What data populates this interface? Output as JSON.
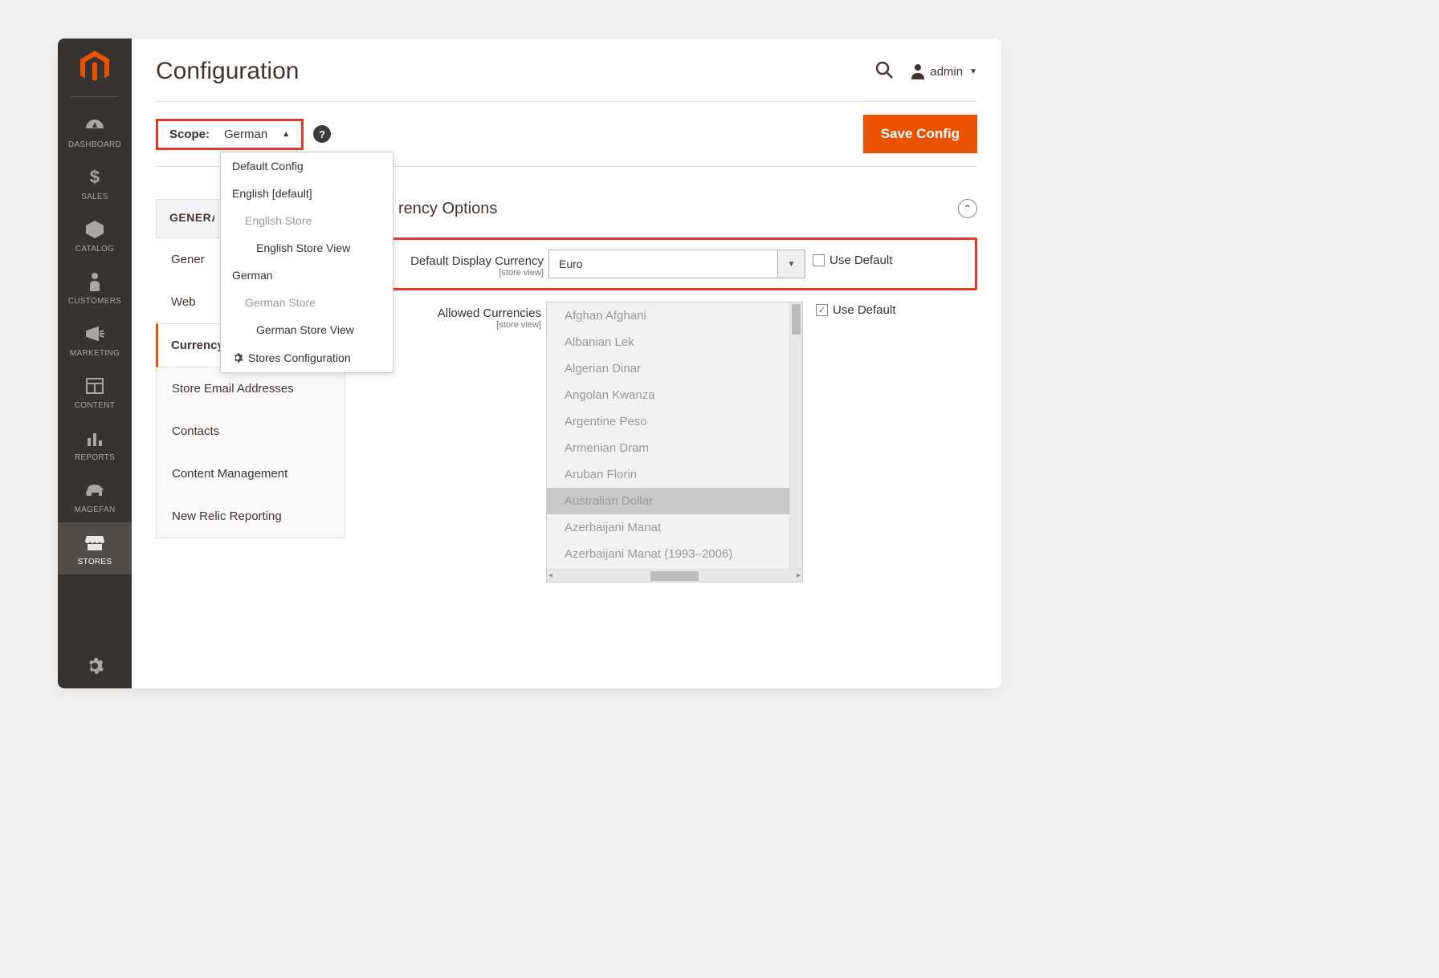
{
  "header": {
    "title": "Configuration",
    "user_label": "admin"
  },
  "scope": {
    "label": "Scope:",
    "value": "German",
    "options": [
      {
        "text": "Default Config",
        "indent": 0
      },
      {
        "text": "English [default]",
        "indent": 0
      },
      {
        "text": "English Store",
        "indent": 1
      },
      {
        "text": "English Store View",
        "indent": 2
      },
      {
        "text": "German",
        "indent": 0
      },
      {
        "text": "German Store",
        "indent": 1
      },
      {
        "text": "German Store View",
        "indent": 2
      }
    ],
    "stores_config": "Stores Configuration"
  },
  "actions": {
    "save": "Save Config"
  },
  "section_nav": {
    "group_label": "GENERAL",
    "items": [
      "General",
      "Web",
      "Currency Setup",
      "Store Email Addresses",
      "Contacts",
      "Content Management",
      "New Relic Reporting"
    ],
    "active_index": 2,
    "truncated": {
      "0": "Gener",
      "1": "Web"
    }
  },
  "panel": {
    "title_suffix": "rency Options",
    "fields": {
      "default_display": {
        "label": "Default Display Currency",
        "scope": "[store view]",
        "value": "Euro",
        "use_default_label": "Use Default",
        "use_default_checked": false
      },
      "allowed": {
        "label": "Allowed Currencies",
        "scope": "[store view]",
        "use_default_label": "Use Default",
        "use_default_checked": true,
        "options": [
          "Afghan Afghani",
          "Albanian Lek",
          "Algerian Dinar",
          "Angolan Kwanza",
          "Argentine Peso",
          "Armenian Dram",
          "Aruban Florin",
          "Australian Dollar",
          "Azerbaijani Manat",
          "Azerbaijani Manat (1993–2006)"
        ],
        "selected_index": 7
      }
    }
  },
  "sidebar": {
    "items": [
      {
        "id": "dashboard",
        "label": "DASHBOARD"
      },
      {
        "id": "sales",
        "label": "SALES"
      },
      {
        "id": "catalog",
        "label": "CATALOG"
      },
      {
        "id": "customers",
        "label": "CUSTOMERS"
      },
      {
        "id": "marketing",
        "label": "MARKETING"
      },
      {
        "id": "content",
        "label": "CONTENT"
      },
      {
        "id": "reports",
        "label": "REPORTS"
      },
      {
        "id": "magefan",
        "label": "MAGEFAN"
      },
      {
        "id": "stores",
        "label": "STORES"
      }
    ],
    "active_index": 8
  },
  "colors": {
    "accent": "#eb5202",
    "highlight": "#e03b2a"
  }
}
